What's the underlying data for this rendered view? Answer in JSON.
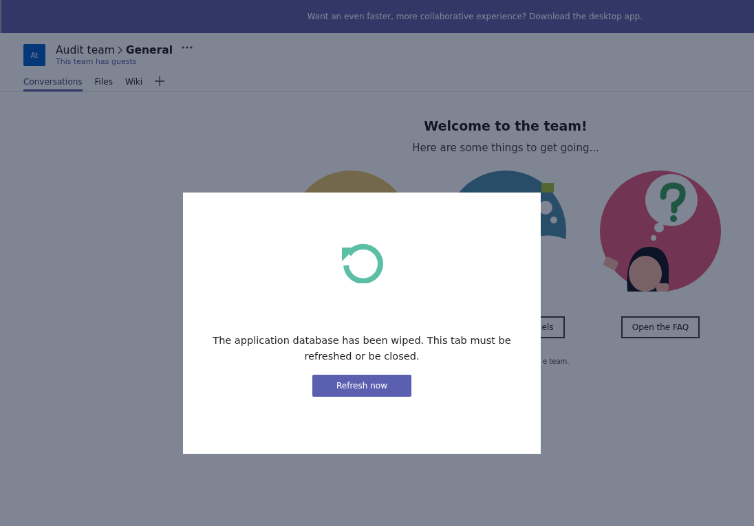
{
  "banner": {
    "text": "Want an even faster, more collaborative experience? Download the desktop app."
  },
  "header": {
    "avatar": "At",
    "team": "Audit team",
    "channel": "General",
    "subtitle": "This team has guests"
  },
  "tabs": [
    {
      "label": "Conversations",
      "selected": true
    },
    {
      "label": "Files",
      "selected": false
    },
    {
      "label": "Wiki",
      "selected": false
    }
  ],
  "welcome": {
    "title": "Welcome to the team!",
    "subtitle": "Here are some things to get going...",
    "cards": [
      {
        "kind": "team"
      },
      {
        "kind": "channels",
        "button": "els"
      },
      {
        "kind": "faq",
        "button": "Open the FAQ"
      }
    ],
    "note": "e team."
  },
  "dialog": {
    "message": "The application database has been wiped. This tab must be refreshed or be closed.",
    "button": "Refresh now"
  }
}
